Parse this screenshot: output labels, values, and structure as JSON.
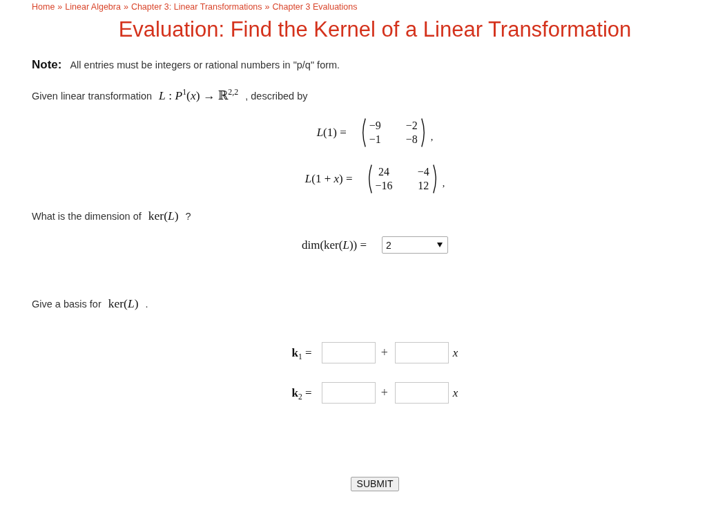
{
  "breadcrumb": {
    "items": [
      {
        "label": "Home"
      },
      {
        "label": "Linear Algebra"
      },
      {
        "label": "Chapter 3: Linear Transformations"
      },
      {
        "label": "Chapter 3 Evaluations"
      }
    ],
    "separators": [
      "»",
      "»",
      "»"
    ]
  },
  "title": "Evaluation: Find the Kernel of a Linear Transformation",
  "note": {
    "label": "Note:",
    "text": "All entries must be integers or rational numbers in \"p/q\" form."
  },
  "intro": {
    "text": "Given linear transformation",
    "math": "*L* : *P*$^{1}$(*x*) → ℝ$^{2,2}$",
    "suffix": ", described by"
  },
  "mappings": [
    {
      "lhs": "*L*(1) =",
      "matrix": [
        [
          "−9",
          "−2"
        ],
        [
          "−1",
          "−8"
        ]
      ],
      "suffix": ","
    },
    {
      "lhs": "*L*(1 + *x*) =",
      "matrix": [
        [
          "24",
          "−4"
        ],
        [
          "−16",
          "12"
        ]
      ],
      "suffix": ","
    }
  ],
  "dimension_question": {
    "text": "What is the dimension of",
    "math": "ker(*L*)",
    "suffix": "?"
  },
  "dimension_answer": {
    "label": "dim(ker(*L*)) =",
    "value": "2"
  },
  "basis_question": {
    "text": "Give a basis for",
    "math": "ker(*L*)",
    "suffix": "."
  },
  "basis": [
    {
      "label": "**k**$_{1}$ =",
      "plus": "+",
      "variable": "x"
    },
    {
      "label": "**k**$_{2}$ =",
      "plus": "+",
      "variable": "x"
    }
  ],
  "submit": "SUBMIT"
}
